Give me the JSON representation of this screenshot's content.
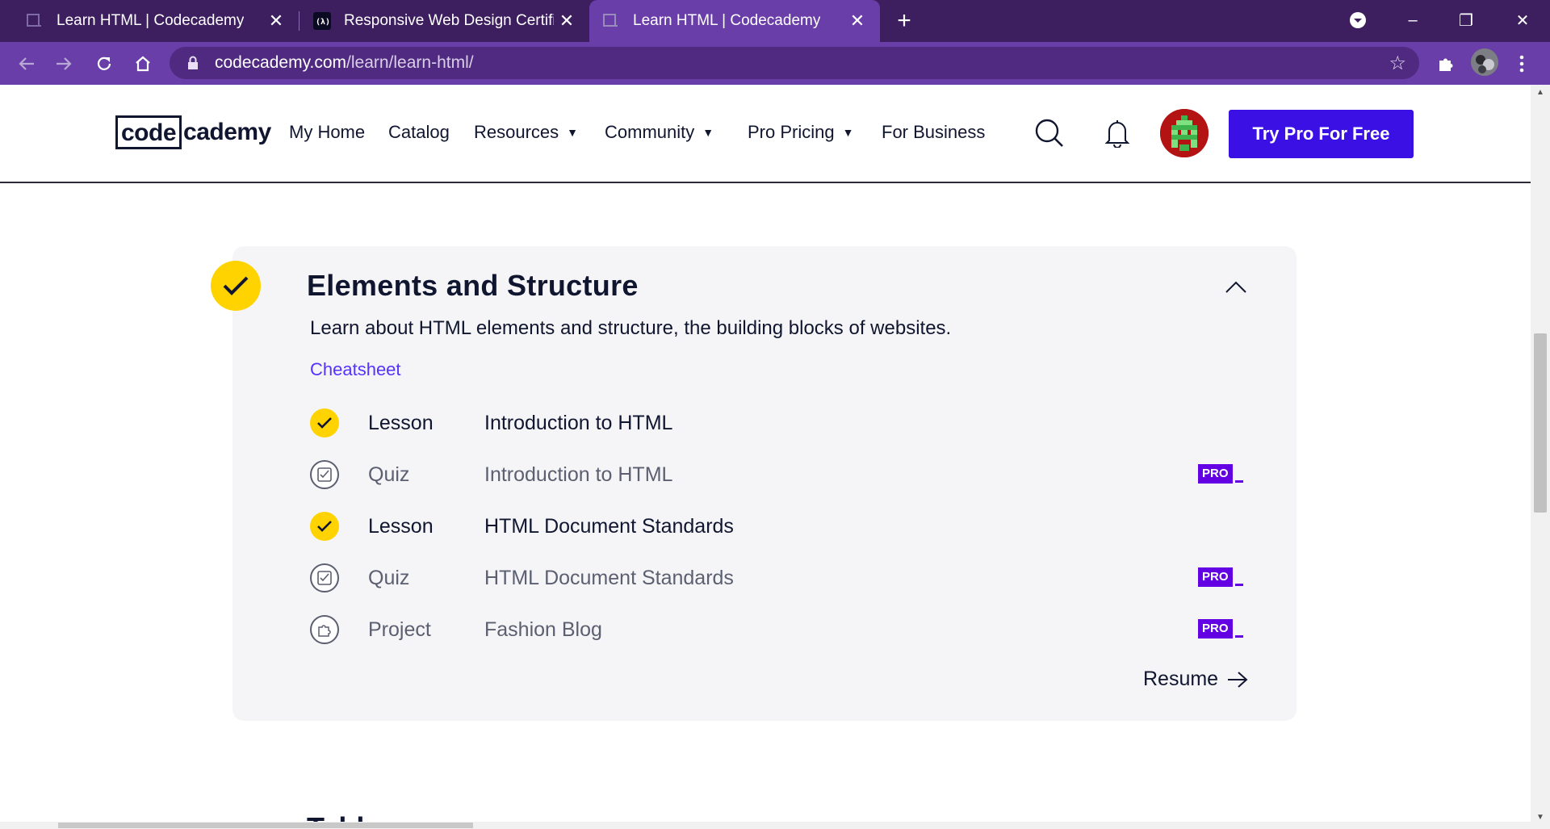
{
  "browser": {
    "tabs": [
      {
        "title": "Learn HTML | Codecademy",
        "favicon": "codecademy-favicon",
        "active": false
      },
      {
        "title": "Responsive Web Design Certificat",
        "favicon": "freecodecamp-favicon",
        "active": false
      },
      {
        "title": "Learn HTML | Codecademy",
        "favicon": "codecademy-favicon",
        "active": true
      }
    ],
    "close_glyph": "✕",
    "new_tab_glyph": "+",
    "url_host": "codecademy.com",
    "url_path": "/learn/learn-html/",
    "window_controls": [
      "–",
      "❐",
      "✕"
    ]
  },
  "nav": {
    "logo_box": "code",
    "logo_rest": "cademy",
    "links": [
      {
        "label": "My Home",
        "has_caret": false
      },
      {
        "label": "Catalog",
        "has_caret": false
      },
      {
        "label": "Resources",
        "has_caret": true
      },
      {
        "label": "Community",
        "has_caret": true
      },
      {
        "label": "Pro Pricing",
        "has_caret": true
      },
      {
        "label": "For Business",
        "has_caret": false
      }
    ],
    "caret": "▼",
    "cta": "Try Pro For Free"
  },
  "section": {
    "title": "Elements and Structure",
    "description": "Learn about HTML elements and structure, the building blocks of websites.",
    "cheatsheet": "Cheatsheet",
    "items": [
      {
        "type": "Lesson",
        "name": "Introduction to HTML",
        "status": "complete",
        "pro": false
      },
      {
        "type": "Quiz",
        "name": "Introduction to HTML",
        "status": "quiz",
        "pro": true
      },
      {
        "type": "Lesson",
        "name": "HTML Document Standards",
        "status": "complete",
        "pro": false
      },
      {
        "type": "Quiz",
        "name": "HTML Document Standards",
        "status": "quiz",
        "pro": true
      },
      {
        "type": "Project",
        "name": "Fashion Blog",
        "status": "project",
        "pro": true
      }
    ],
    "pro_label": "PRO",
    "resume": "Resume",
    "next_section_partial": "Tabl"
  },
  "colors": {
    "brand_purple": "#3a10e5",
    "pro_purple": "#6400e4",
    "check_yellow": "#ffd300",
    "text_navy": "#10162f",
    "chrome_purple": "#6a3ea8"
  }
}
